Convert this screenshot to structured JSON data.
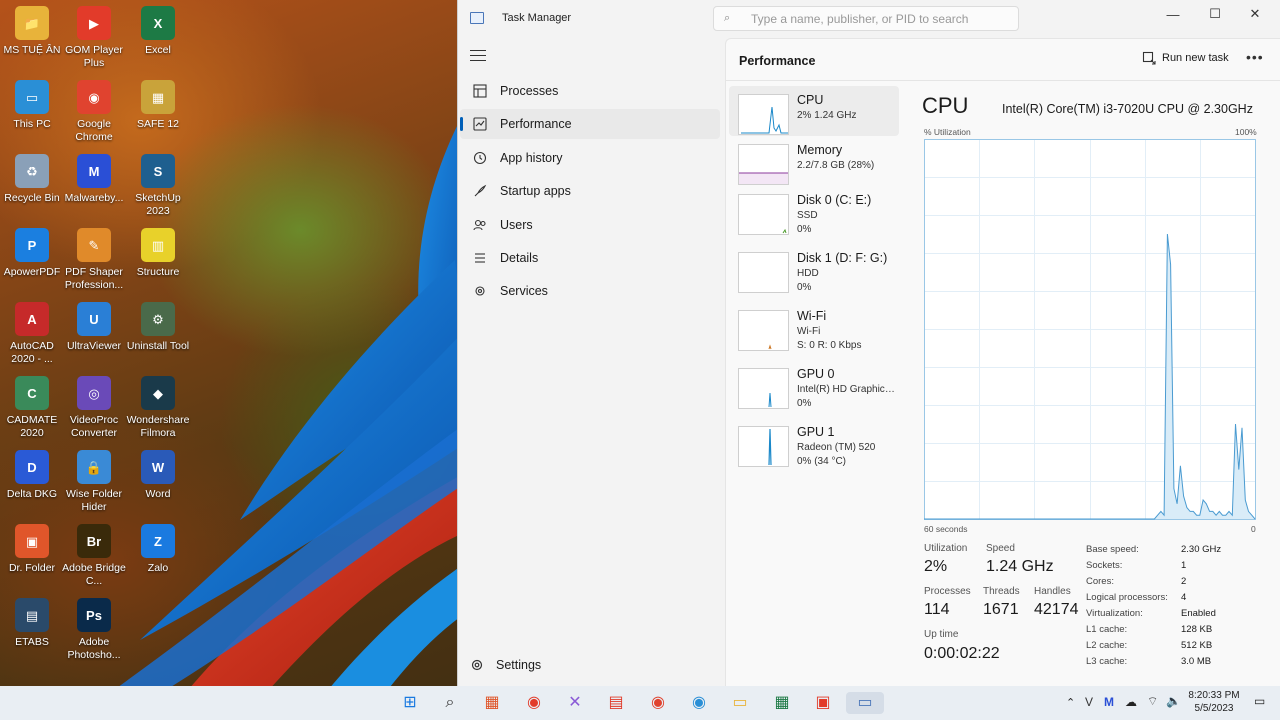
{
  "desktop": {
    "icons": [
      {
        "label": "MS TUỆ ÂN",
        "glyph": "📁",
        "color": "#e8b33a"
      },
      {
        "label": "GOM Player Plus",
        "glyph": "▶",
        "color": "#e23b2a"
      },
      {
        "label": "Excel",
        "glyph": "X",
        "color": "#1d7a45"
      },
      {
        "label": "This PC",
        "glyph": "▭",
        "color": "#2a8fd6"
      },
      {
        "label": "Google Chrome",
        "glyph": "◉",
        "color": "#e0432f"
      },
      {
        "label": "SAFE 12",
        "glyph": "▦",
        "color": "#c9a33a"
      },
      {
        "label": "Recycle Bin",
        "glyph": "♻",
        "color": "#8aa0b8"
      },
      {
        "label": "Malwareby...",
        "glyph": "M",
        "color": "#2a4fd6"
      },
      {
        "label": "SketchUp 2023",
        "glyph": "S",
        "color": "#1e5f8f"
      },
      {
        "label": "ApowerPDF",
        "glyph": "P",
        "color": "#1b7fe0"
      },
      {
        "label": "PDF Shaper Profession...",
        "glyph": "✎",
        "color": "#e08a2a"
      },
      {
        "label": "Structure",
        "glyph": "▥",
        "color": "#e8d12a"
      },
      {
        "label": "AutoCAD 2020 - ...",
        "glyph": "A",
        "color": "#c62a2a"
      },
      {
        "label": "UltraViewer",
        "glyph": "U",
        "color": "#2a7fd6"
      },
      {
        "label": "Uninstall Tool",
        "glyph": "⚙",
        "color": "#4a6a4a"
      },
      {
        "label": "CADMATE 2020",
        "glyph": "C",
        "color": "#3a8a5a"
      },
      {
        "label": "VideoProc Converter",
        "glyph": "◎",
        "color": "#6a4ab8"
      },
      {
        "label": "Wondershare Filmora",
        "glyph": "◆",
        "color": "#1a3a4a"
      },
      {
        "label": "Delta DKG",
        "glyph": "D",
        "color": "#2a5ad6"
      },
      {
        "label": "Wise Folder Hider",
        "glyph": "🔒",
        "color": "#3a8ad6"
      },
      {
        "label": "Word",
        "glyph": "W",
        "color": "#2a5ab8"
      },
      {
        "label": "Dr. Folder",
        "glyph": "▣",
        "color": "#e0562a"
      },
      {
        "label": "Adobe Bridge C...",
        "glyph": "Br",
        "color": "#3a2a0a"
      },
      {
        "label": "Zalo",
        "glyph": "Z",
        "color": "#1a7ae0"
      },
      {
        "label": "ETABS",
        "glyph": "▤",
        "color": "#2a4a6a"
      },
      {
        "label": "Adobe Photosho...",
        "glyph": "Ps",
        "color": "#0a2a4a"
      }
    ]
  },
  "window": {
    "title": "Task Manager",
    "search_placeholder": "Type a name, publisher, or PID to search",
    "controls": {
      "minimize": "—",
      "maximize": "☐",
      "close": "✕"
    }
  },
  "sidebar": {
    "items": [
      {
        "label": "Processes",
        "icon": "processes-icon"
      },
      {
        "label": "Performance",
        "icon": "performance-icon",
        "active": true
      },
      {
        "label": "App history",
        "icon": "history-icon"
      },
      {
        "label": "Startup apps",
        "icon": "startup-icon"
      },
      {
        "label": "Users",
        "icon": "users-icon"
      },
      {
        "label": "Details",
        "icon": "details-icon"
      },
      {
        "label": "Services",
        "icon": "services-icon"
      }
    ],
    "settings_label": "Settings"
  },
  "content": {
    "header_title": "Performance",
    "run_new_task": "Run new task",
    "more": "•••"
  },
  "devices": [
    {
      "name": "CPU",
      "line1": "2%  1.24 GHz",
      "line2": "",
      "accent": "#1a88c9"
    },
    {
      "name": "Memory",
      "line1": "2.2/7.8 GB (28%)",
      "line2": "",
      "accent": "#8b3a9c"
    },
    {
      "name": "Disk 0 (C: E:)",
      "line1": "SSD",
      "line2": "0%",
      "accent": "#4a9a2a"
    },
    {
      "name": "Disk 1 (D: F: G:)",
      "line1": "HDD",
      "line2": "0%",
      "accent": "#4a9a2a"
    },
    {
      "name": "Wi-Fi",
      "line1": "Wi-Fi",
      "line2": "S: 0 R: 0 Kbps",
      "accent": "#c9701a"
    },
    {
      "name": "GPU 0",
      "line1": "Intel(R) HD Graphics ...",
      "line2": "0%",
      "accent": "#1a88c9"
    },
    {
      "name": "GPU 1",
      "line1": "Radeon (TM) 520",
      "line2": "0%  (34 °C)",
      "accent": "#1a88c9"
    }
  ],
  "detail": {
    "title": "CPU",
    "model": "Intel(R) Core(TM) i3-7020U CPU @ 2.30GHz",
    "util_label": "% Utilization",
    "util_max": "100%",
    "x_left": "60 seconds",
    "x_right": "0",
    "stats": {
      "utilization_label": "Utilization",
      "utilization": "2%",
      "speed_label": "Speed",
      "speed": "1.24 GHz",
      "processes_label": "Processes",
      "processes": "114",
      "threads_label": "Threads",
      "threads": "1671",
      "handles_label": "Handles",
      "handles": "42174",
      "uptime_label": "Up time",
      "uptime": "0:00:02:22"
    },
    "specs": [
      {
        "k": "Base speed:",
        "v": "2.30 GHz"
      },
      {
        "k": "Sockets:",
        "v": "1"
      },
      {
        "k": "Cores:",
        "v": "2"
      },
      {
        "k": "Logical processors:",
        "v": "4"
      },
      {
        "k": "Virtualization:",
        "v": "Enabled"
      },
      {
        "k": "L1 cache:",
        "v": "128 KB"
      },
      {
        "k": "L2 cache:",
        "v": "512 KB"
      },
      {
        "k": "L3 cache:",
        "v": "3.0 MB"
      }
    ],
    "cpu_history": [
      0,
      0,
      0,
      0,
      0,
      0,
      0,
      0,
      0,
      0,
      0,
      0,
      0,
      0,
      0,
      0,
      0,
      0,
      0,
      0,
      0,
      0,
      0,
      0,
      0,
      0,
      0,
      0,
      0,
      0,
      0,
      0,
      0,
      0,
      0,
      0,
      0,
      0,
      0,
      0,
      0,
      0,
      0,
      0,
      0,
      0,
      0,
      0,
      0,
      0,
      0,
      0,
      0,
      0,
      0,
      0,
      0,
      0,
      0,
      0,
      0,
      0,
      0,
      0,
      0,
      0,
      0,
      0,
      0,
      0,
      0,
      0,
      1,
      2,
      1,
      75,
      67,
      8,
      4,
      14,
      6,
      3,
      2,
      2,
      1,
      1,
      5,
      4,
      2,
      2,
      1,
      2,
      1,
      1,
      2,
      1,
      25,
      13,
      24,
      5,
      2,
      1,
      0
    ]
  },
  "taskbar": {
    "apps": [
      "start-icon",
      "search-icon",
      "store-icon",
      "gom-icon",
      "xmind-icon",
      "pdf-icon",
      "chrome-icon",
      "chrome-alt-icon",
      "explorer-icon",
      "calculator-icon",
      "wps-icon",
      "taskmanager-icon"
    ],
    "time": "8:20:33 PM",
    "date": "5/5/2023"
  }
}
